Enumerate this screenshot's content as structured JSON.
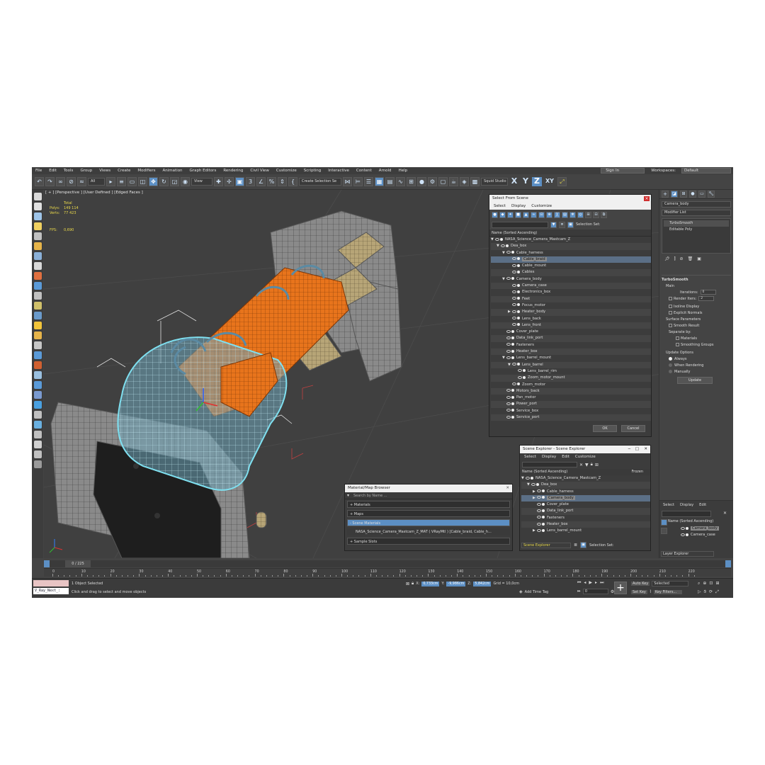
{
  "menubar": {
    "items": [
      "File",
      "Edit",
      "Tools",
      "Group",
      "Views",
      "Create",
      "Modifiers",
      "Animation",
      "Graph Editors",
      "Rendering",
      "Civil View",
      "Customize",
      "Scripting",
      "Interactive",
      "Content",
      "Arnold",
      "Help"
    ],
    "sign_in": "Sign In",
    "workspaces_label": "Workspaces:",
    "workspace_value": "Default"
  },
  "toolbar": {
    "filter_value": "All",
    "view_value": "View",
    "selection_set": "Create Selection Se",
    "squid_studio": "Squid Studio v",
    "axis_x": "X",
    "axis_y": "Y",
    "axis_z": "Z",
    "axis_xy": "XY"
  },
  "viewport": {
    "label": "[ + ] [Perspective ] [User Defined ] [Edged Faces ]",
    "stats": {
      "total_label": "Total",
      "polys_label": "Polys:",
      "polys_value": "149 114",
      "verts_label": "Verts:",
      "verts_value": "77 423",
      "fps_label": "FPS:",
      "fps_value": "0,690"
    }
  },
  "select_from_scene": {
    "title": "Select From Scene",
    "menu": [
      "Select",
      "Display",
      "Customize"
    ],
    "selection_set_label": "Selection Set:",
    "header": "Name (Sorted Ascending)",
    "rows": [
      {
        "name": "NASA_Science_Camera_Mastcam_Z",
        "level": 0,
        "arrow": "▼"
      },
      {
        "name": "Dea_box",
        "level": 1,
        "arrow": "▼"
      },
      {
        "name": "Cable_harness",
        "level": 2,
        "arrow": "▼"
      },
      {
        "name": "Cable_braid",
        "level": 3,
        "arrow": "",
        "sel": true
      },
      {
        "name": "Cable_mount",
        "level": 3,
        "arrow": ""
      },
      {
        "name": "Cables",
        "level": 3,
        "arrow": ""
      },
      {
        "name": "Camera_body",
        "level": 2,
        "arrow": "▼"
      },
      {
        "name": "Camera_case",
        "level": 3,
        "arrow": ""
      },
      {
        "name": "Electronics_box",
        "level": 3,
        "arrow": ""
      },
      {
        "name": "Feet",
        "level": 3,
        "arrow": ""
      },
      {
        "name": "Focus_motor",
        "level": 3,
        "arrow": ""
      },
      {
        "name": "Heater_body",
        "level": 3,
        "arrow": "▶"
      },
      {
        "name": "Lens_back",
        "level": 3,
        "arrow": ""
      },
      {
        "name": "Lens_front",
        "level": 3,
        "arrow": ""
      },
      {
        "name": "Cover_plate",
        "level": 2,
        "arrow": ""
      },
      {
        "name": "Data_link_port",
        "level": 2,
        "arrow": ""
      },
      {
        "name": "Fasteners",
        "level": 2,
        "arrow": ""
      },
      {
        "name": "Heater_box",
        "level": 2,
        "arrow": ""
      },
      {
        "name": "Lens_barrel_mount",
        "level": 2,
        "arrow": "▼"
      },
      {
        "name": "Lens_barrel",
        "level": 3,
        "arrow": "▼"
      },
      {
        "name": "Lens_barrel_rim",
        "level": 4,
        "arrow": ""
      },
      {
        "name": "Zoom_motor_mount",
        "level": 4,
        "arrow": ""
      },
      {
        "name": "Zoom_motor",
        "level": 3,
        "arrow": ""
      },
      {
        "name": "Motors_back",
        "level": 2,
        "arrow": ""
      },
      {
        "name": "Pan_motor",
        "level": 2,
        "arrow": ""
      },
      {
        "name": "Power_port",
        "level": 2,
        "arrow": ""
      },
      {
        "name": "Service_box",
        "level": 2,
        "arrow": ""
      },
      {
        "name": "Service_port",
        "level": 2,
        "arrow": ""
      }
    ],
    "ok": "OK",
    "cancel": "Cancel"
  },
  "scene_explorer": {
    "title": "Scene Explorer - Scene Explorer",
    "menu": [
      "Select",
      "Display",
      "Edit",
      "Customize"
    ],
    "header": "Name (Sorted Ascending)",
    "frozen": "Frozen",
    "rows": [
      {
        "name": "NASA_Science_Camera_Mastcam_Z",
        "level": 0,
        "arrow": "▼"
      },
      {
        "name": "Dea_box",
        "level": 1,
        "arrow": "▼"
      },
      {
        "name": "Cable_harness",
        "level": 2,
        "arrow": "▶"
      },
      {
        "name": "Camera_body",
        "level": 2,
        "arrow": "▶",
        "sel": true
      },
      {
        "name": "Cover_plate",
        "level": 2,
        "arrow": ""
      },
      {
        "name": "Data_link_port",
        "level": 2,
        "arrow": ""
      },
      {
        "name": "Fasteners",
        "level": 2,
        "arrow": ""
      },
      {
        "name": "Heater_box",
        "level": 2,
        "arrow": ""
      },
      {
        "name": "Lens_barrel_mount",
        "level": 2,
        "arrow": "▶"
      }
    ],
    "footer_label": "Scene Explorer",
    "selection_set_label": "Selection Set:"
  },
  "material_browser": {
    "title": "Material/Map Browser",
    "search_placeholder": "Search by Name ...",
    "sections": [
      {
        "label": "+ Materials"
      },
      {
        "label": "+ Maps"
      },
      {
        "label": "- Scene Materials",
        "active": true
      },
      {
        "label": "+ Sample Slots"
      }
    ],
    "scene_material": "NASA_Science_Camera_Mastcam_Z_MAT  ( VRayMtl ) [Cable_braid, Cable_h..."
  },
  "command_panel": {
    "object_name": "Camera_body",
    "modifier_list": "Modifier List",
    "stack": [
      "TurboSmooth",
      "Editable Poly"
    ],
    "turbosmooth_title": "TurboSmooth",
    "main_label": "Main",
    "iterations_label": "Iterations:",
    "iterations_value": "0",
    "render_iters_label": "Render Iters:",
    "render_iters_value": "2",
    "isoline_display": "Isoline Display",
    "explicit_normals": "Explicit Normals",
    "surface_params": "Surface Parameters",
    "smooth_result": "Smooth Result",
    "separate_by": "Separate by:",
    "materials": "Materials",
    "smoothing_groups": "Smoothing Groups",
    "update_options": "Update Options",
    "always": "Always",
    "when_rendering": "When Rendering",
    "manually": "Manually",
    "update_button": "Update",
    "layer_menu": [
      "Select",
      "Display",
      "Edit"
    ],
    "layer_header": "Name (Sorted Ascending)",
    "layer_rows": [
      "Camera_body",
      "Camera_case"
    ],
    "layer_explorer": "Layer Explorer"
  },
  "timeline": {
    "frame_display": "0 / 225",
    "ticks": [
      "0",
      "10",
      "20",
      "30",
      "40",
      "50",
      "60",
      "70",
      "80",
      "90",
      "100",
      "110",
      "120",
      "130",
      "140",
      "150",
      "160",
      "170",
      "180",
      "190",
      "200",
      "210",
      "220"
    ]
  },
  "statusbar": {
    "script_listener": "V_Ray_Next_:",
    "selected_status": "1 Object Selected",
    "prompt": "Click and drag to select and move objects",
    "x_label": "X:",
    "x_value": "0,733cm",
    "y_label": "Y:",
    "y_value": "-9,986cm",
    "z_label": "Z:",
    "z_value": "5,842cm",
    "grid": "Grid = 10,0cm",
    "add_time_tag": "Add Time Tag",
    "auto_key": "Auto Key",
    "selected_value": "Selected",
    "set_key": "Set Key",
    "key_filters": "Key Filters...",
    "frame_field": "0"
  },
  "colors": {
    "accent": "#5c8fc4",
    "orange_mesh": "#e8741c",
    "cyan_selection": "#7fe0f0",
    "stats_yellow": "#e9d84a"
  }
}
